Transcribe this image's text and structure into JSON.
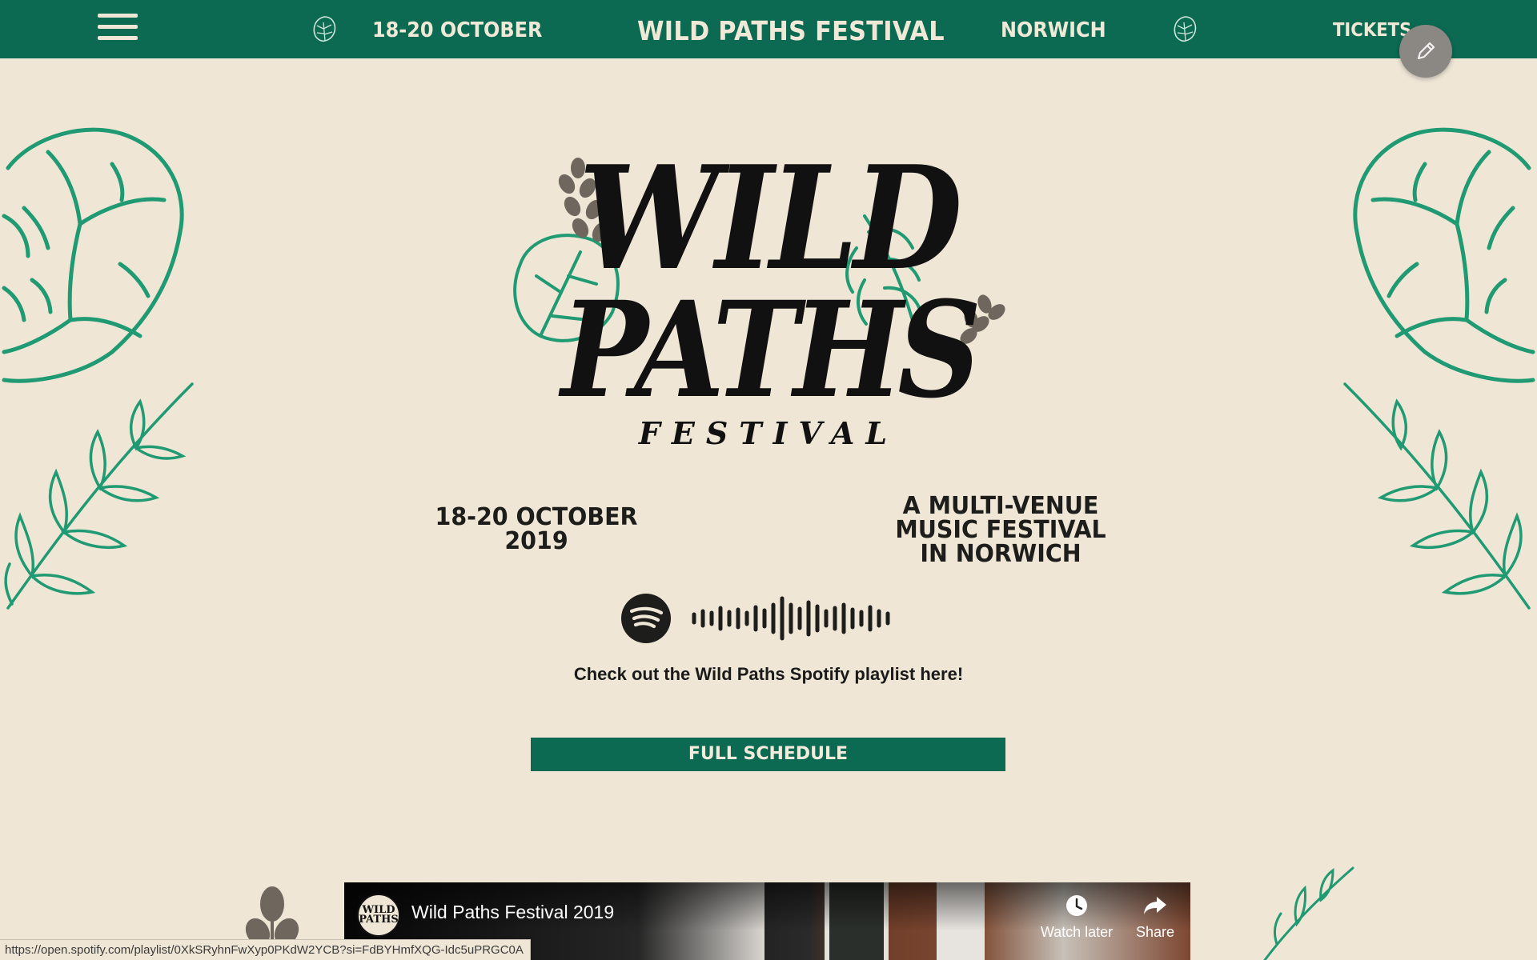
{
  "header": {
    "menu_icon": "hamburger-menu-icon",
    "date": "18-20 OCTOBER",
    "title": "WILD PATHS FESTIVAL",
    "city": "NORWICH",
    "tickets": "TICKETS",
    "leaf_icon": "monstera-leaf-icon",
    "edit_icon": "pencil-icon"
  },
  "logo": {
    "line1": "WILD",
    "line2": "PATHS",
    "line3": "FESTIVAL"
  },
  "info": {
    "date_line1": "18-20 OCTOBER",
    "date_line2": "2019",
    "desc_line1": "A MULTI-VENUE",
    "desc_line2": "MUSIC FESTIVAL",
    "desc_line3": "IN NORWICH"
  },
  "spotify": {
    "icon": "spotify-icon",
    "playlist_text": "Check out the Wild Paths Spotify playlist here!"
  },
  "schedule_button": "FULL SCHEDULE",
  "video": {
    "channel_avatar_text": "WILD PATHS",
    "title": "Wild Paths Festival 2019",
    "watch_later": "Watch later",
    "share": "Share"
  },
  "status_url": "https://open.spotify.com/playlist/0XkSRyhnFwXyp0PKdW2YCB?si=FdBYHmfXQG-Idc5uPRGC0A",
  "colors": {
    "brand_green": "#0c6a52",
    "background": "#efe6d6",
    "leaf_green": "#1f9a72",
    "fern_brown": "#6f665d"
  }
}
